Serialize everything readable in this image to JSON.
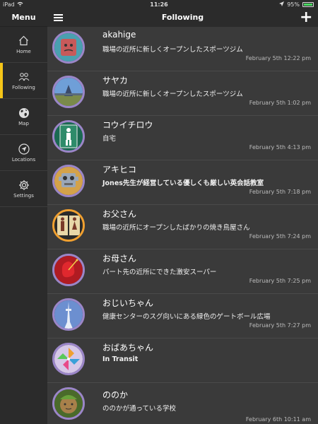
{
  "status_bar": {
    "device": "iPad",
    "time": "11:26",
    "battery": "95%"
  },
  "sidebar": {
    "title": "Menu",
    "items": [
      {
        "label": "Home",
        "icon": "home-icon"
      },
      {
        "label": "Following",
        "icon": "people-icon",
        "active": true
      },
      {
        "label": "Map",
        "icon": "globe-icon"
      },
      {
        "label": "Locations",
        "icon": "location-arrow-icon"
      },
      {
        "label": "Settings",
        "icon": "gear-icon"
      }
    ]
  },
  "header": {
    "title": "Following",
    "add_label": "+"
  },
  "list": [
    {
      "name": "akahige",
      "place": "職場の近所に新しくオープンしたスポーツジム",
      "time": "February 5th 12:22 pm",
      "avatar_color": "#c75a5a",
      "avatar_bg": "#4aa0b0"
    },
    {
      "name": "サヤカ",
      "place": "職場の近所に新しくオープンしたスポーツジム",
      "time": "February 5th 1:02 pm",
      "avatar_color": "#7fa6d6",
      "avatar_bg": "#2f5f9a"
    },
    {
      "name": "コウイチロウ",
      "place": "自宅",
      "time": "February 5th 4:13 pm",
      "avatar_color": "#2e8b6a",
      "avatar_bg": "#1a6a52"
    },
    {
      "name": "アキヒコ",
      "place": "Jones先生が経営している優しくも厳しい英会話教室",
      "place_bold": true,
      "time": "February 5th 7:18 pm",
      "avatar_color": "#9aa7b8",
      "avatar_bg": "#d4a24a"
    },
    {
      "name": "お父さん",
      "place": "職場の近所にオープンしたばかりの焼き鳥屋さん",
      "time": "February 5th 7:24 pm",
      "avatar_color": "#e8d7a8",
      "avatar_bg": "#2a2a2a"
    },
    {
      "name": "お母さん",
      "place": "パート先の近所にできた激安スーパー",
      "time": "February 5th 7:25 pm",
      "avatar_color": "#e0282e",
      "avatar_bg": "#b01b22"
    },
    {
      "name": "おじいちゃん",
      "place": "健康センターのスグ向いにある緑色のゲートボール広場",
      "time": "February 5th 7:27 pm",
      "avatar_color": "#6c8fd0",
      "avatar_bg": "#3a5e9a"
    },
    {
      "name": "おばあちゃん",
      "place": "In Transit",
      "place_bold": true,
      "time": "",
      "avatar_color": "#f0a030",
      "avatar_bg": "#d6c8e8"
    },
    {
      "name": "ののか",
      "place": "ののかが通っている学校",
      "time": "February 6th 10:11 am",
      "avatar_color": "#7a9a4a",
      "avatar_bg": "#4a6a2a"
    }
  ]
}
